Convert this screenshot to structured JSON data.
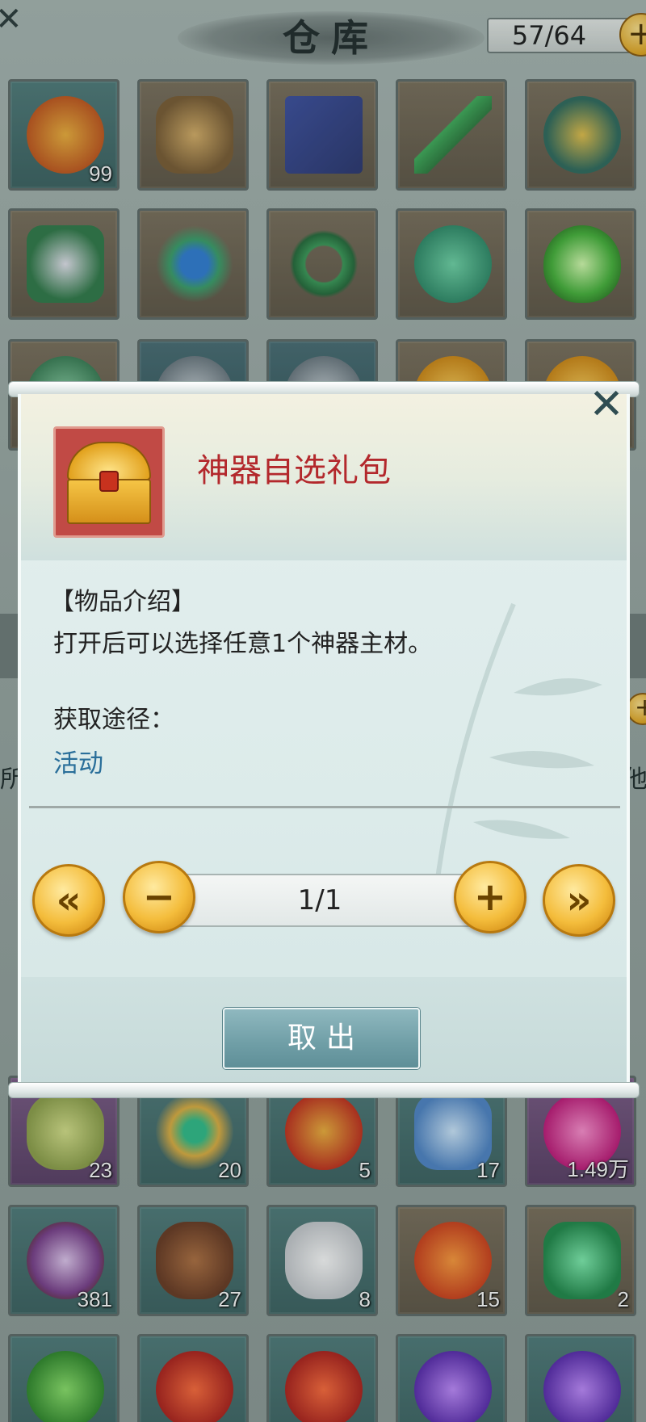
{
  "warehouse": {
    "title": "仓库",
    "capacity": "57/64",
    "side_left_fragment": "所",
    "side_right_fragment": "他",
    "visible_counts": {
      "row1_slot1": "99",
      "row6_slot1": "23",
      "row6_slot2": "20",
      "row6_slot3": "5",
      "row6_slot4": "17",
      "row6_slot5": "1.49万",
      "row7_slot1": "381",
      "row7_slot2": "27",
      "row7_slot3": "8",
      "row7_slot4": "15",
      "row7_slot5": "2"
    },
    "icons": {
      "back": "back-arrow-icon",
      "add_capacity": "plus-icon"
    }
  },
  "item_popup": {
    "name": "神器自选礼包",
    "icon": "treasure-chest-icon",
    "description_heading": "【物品介绍】",
    "description": "打开后可以选择任意1个神器主材。",
    "source_heading": "获取途径：",
    "source_link": "活动",
    "quantity": "1/1",
    "quantity_fraction": 1.0,
    "controls": {
      "min_icon": "double-chevron-left-icon",
      "decrease_icon": "minus-icon",
      "increase_icon": "plus-icon",
      "max_icon": "double-chevron-right-icon",
      "close_icon": "close-icon"
    },
    "take_out_label": "取出"
  },
  "colors": {
    "item_name": "#b3282c",
    "source_link": "#2a6f9a",
    "gold_button": "#f4bd3c",
    "action_button": "#6f9ea6"
  }
}
